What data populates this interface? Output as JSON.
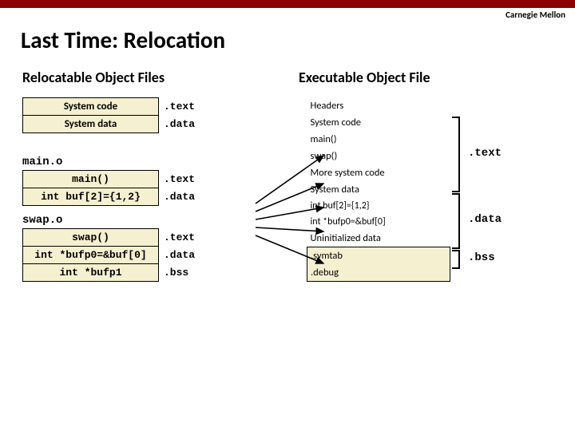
{
  "brand": "Carnegie Mellon",
  "title": "Last Time: Relocation",
  "left": {
    "heading": "Relocatable Object Files",
    "syscode": "System code",
    "sysdata": "System data",
    "sec_text": ".text",
    "sec_data": ".data",
    "sec_bss": ".bss",
    "main_o": "main.o",
    "main_fn": "main()",
    "buf_decl": "int buf[2]={1,2}",
    "swap_o": "swap.o",
    "swap_fn": "swap()",
    "bufp0_decl": "int *bufp0=&buf[0]",
    "bufp1_decl": "int *bufp1"
  },
  "right": {
    "heading": "Executable Object File",
    "headers": "Headers",
    "syscode": "System code",
    "main_fn": "main()",
    "swap_fn": "swap()",
    "more_sys": "More system code",
    "sysdata": "System data",
    "buf_decl": "int buf[2]={1,2}",
    "bufp0_decl": "int *bufp0=&buf[0]",
    "uninit": "Uninitialized data",
    "symtab": ".symtab",
    "debug": ".debug",
    "sec_text": ".text",
    "sec_data": ".data",
    "sec_bss": ".bss"
  }
}
